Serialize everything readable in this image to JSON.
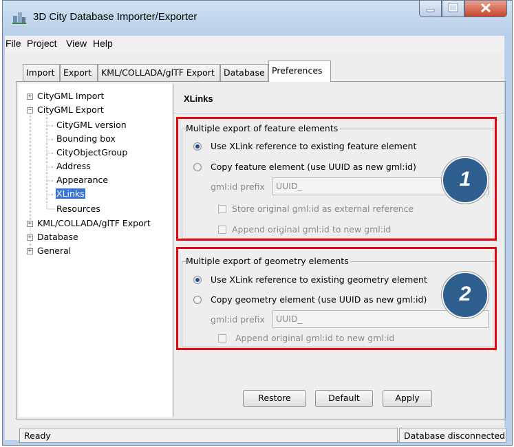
{
  "window": {
    "title": "3D City Database Importer/Exporter"
  },
  "menu": [
    "File",
    "Project",
    "View",
    "Help"
  ],
  "tabs": [
    {
      "label": "Import"
    },
    {
      "label": "Export"
    },
    {
      "label": "KML/COLLADA/glTF Export"
    },
    {
      "label": "Database"
    },
    {
      "label": "Preferences",
      "active": true
    }
  ],
  "tree": {
    "cityGMLImport": "CityGML Import",
    "cityGMLExport": "CityGML Export",
    "exportChildren": [
      "CityGML version",
      "Bounding box",
      "CityObjectGroup",
      "Address",
      "Appearance",
      "XLinks",
      "Resources"
    ],
    "selected": "XLinks",
    "kmlExport": "KML/COLLADA/glTF Export",
    "database": "Database",
    "general": "General"
  },
  "panel": {
    "title": "XLinks",
    "feature": {
      "legend": "Multiple export of feature elements",
      "radio_xlink": "Use XLink reference to existing feature element",
      "radio_copy": "Copy feature element (use UUID as new gml:id)",
      "prefix_label": "gml:id prefix",
      "prefix_value": "UUID_",
      "check_store": "Store original gml:id as external reference",
      "check_append": "Append original gml:id to new gml:id",
      "badge": "1"
    },
    "geometry": {
      "legend": "Multiple export of geometry elements",
      "radio_xlink": "Use XLink reference to existing geometry element",
      "radio_copy": "Copy geometry element (use UUID as new gml:id)",
      "prefix_label": "gml:id prefix",
      "prefix_value": "UUID_",
      "check_append": "Append original gml:id to new gml:id",
      "badge": "2"
    }
  },
  "buttons": {
    "restore": "Restore",
    "default": "Default",
    "apply": "Apply"
  },
  "status": {
    "left": "Ready",
    "right": "Database disconnected"
  },
  "colors": {
    "highlight_box": "#e30613",
    "selection": "#3875d7",
    "badge": "#2f5f8f"
  }
}
